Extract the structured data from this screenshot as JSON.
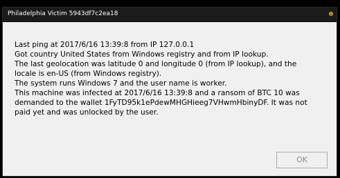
{
  "window": {
    "title": "Philadelphia Victim 5943df7c2ea18"
  },
  "message": {
    "lines": [
      "Last ping at 2017/6/16 13:39:8 from IP 127.0.0.1",
      "Got country United States from Windows registry and  from IP lookup.",
      "The last geolocation was latitude 0 and longitude 0 (from IP lookup), and the",
      "locale is en-US (from Windows registry).",
      "The system runs Windows 7 and the user name is worker.",
      "This machine was infected at 2017/6/16 13:39:8 and a ransom of BTC 10 was",
      "demanded to the wallet 1FyTD95k1ePdewMHGHieeg7VHwmHbinyDF. It was not",
      "paid yet and was unlocked by the user."
    ]
  },
  "buttons": {
    "ok_label": "OK"
  },
  "colors": {
    "titlebar": "#1b1b1b",
    "window_bg": "#f0f0f0",
    "close_dot": "#b87810"
  }
}
